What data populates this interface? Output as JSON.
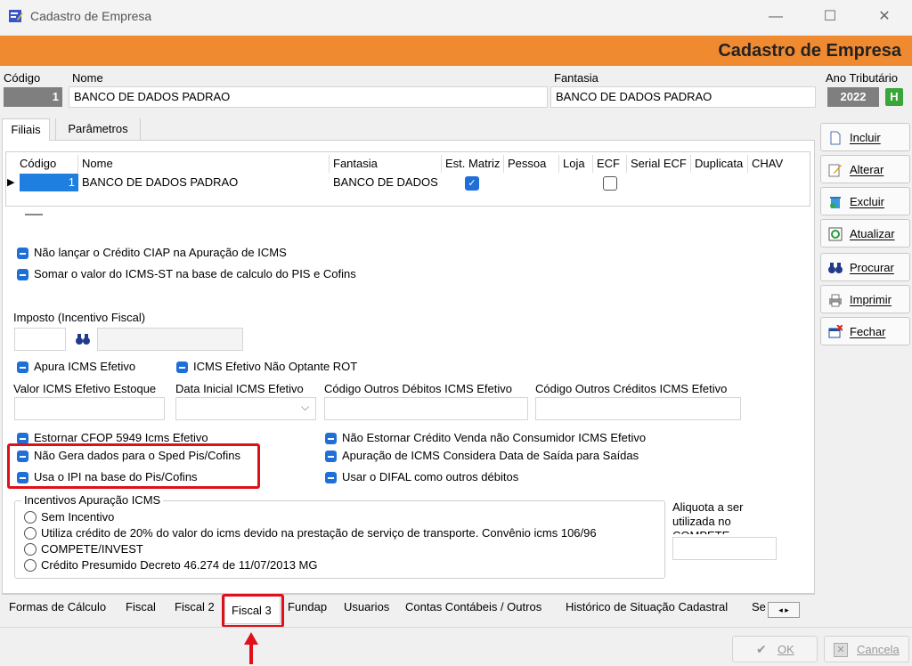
{
  "window": {
    "title": "Cadastro de Empresa",
    "minimize": "—",
    "maximize": "☐",
    "close": "✕"
  },
  "header": {
    "title": "Cadastro de Empresa"
  },
  "top": {
    "codigo_label": "Código",
    "codigo_value": "1",
    "nome_label": "Nome",
    "nome_value": "BANCO DE DADOS PADRAO",
    "fantasia_label": "Fantasia",
    "fantasia_value": "BANCO DE DADOS PADRAO",
    "ano_label": "Ano Tributário",
    "ano_value": "2022",
    "ano_btn": "H"
  },
  "tabs_top": [
    "Filiais",
    "Parâmetros"
  ],
  "grid": {
    "columns": [
      "Código",
      "Nome",
      "Fantasia",
      "Est. Matriz",
      "Pessoa",
      "Loja",
      "ECF",
      "Serial ECF",
      "Duplicata",
      "CHAV"
    ],
    "row": {
      "codigo": "1",
      "nome": "BANCO DE DADOS PADRAO",
      "fantasia": "BANCO DE DADOS"
    }
  },
  "options": {
    "ciap": "Não lançar o Crédito CIAP na Apuração de ICMS",
    "icms_st": "Somar o valor do ICMS-ST na base de calculo do PIS e Cofins",
    "imposto_label": "Imposto (Incentivo Fiscal)",
    "apura_efetivo": "Apura ICMS Efetivo",
    "efetivo_rot": "ICMS Efetivo Não Optante ROT",
    "valor_estoque": "Valor ICMS Efetivo Estoque",
    "data_inicial": "Data Inicial ICMS Efetivo",
    "outros_debitos": "Código Outros Débitos ICMS Efetivo",
    "outros_creditos": "Código Outros Créditos ICMS Efetivo",
    "estornar_cfop": "Estornar CFOP 5949 Icms Efetivo",
    "nao_gera_sped": "Não Gera dados para o Sped Pis/Cofins",
    "ipi_base": "Usa o IPI na base do Pis/Cofins",
    "nao_estornar": "Não Estornar Crédito Venda não Consumidor ICMS Efetivo",
    "apuracao_saida": "Apuração de ICMS Considera Data de Saída para Saídas",
    "difal": "Usar o DIFAL como outros débitos"
  },
  "incentivos": {
    "legend": "Incentivos Apuração ICMS",
    "radios": [
      "Sem Incentivo",
      "Utiliza crédito de 20% do valor do icms devido na prestação de serviço de transporte. Convênio icms 106/96",
      "COMPETE/INVEST",
      "Crédito Presumido Decreto 46.274 de 11/07/2013 MG"
    ],
    "aliquota_label": "Aliquota a ser utilizada no COMPETE"
  },
  "tabs_bottom": [
    "Formas de Cálculo",
    "Fiscal",
    "Fiscal 2",
    "Fiscal 3",
    "Fundap",
    "Usuarios",
    "Contas Contábeis / Outros",
    "Histórico de Situação Cadastral",
    "Se"
  ],
  "buttons": {
    "incluir": "Incluir",
    "alterar": "Alterar",
    "excluir": "Excluir",
    "atualizar": "Atualizar",
    "procurar": "Procurar",
    "imprimir": "Imprimir",
    "fechar": "Fechar",
    "ok": "OK",
    "cancela": "Cancela"
  },
  "colors": {
    "header": "#f08a30",
    "accent": "#1f6fd8",
    "highlight": "#e0101a"
  }
}
